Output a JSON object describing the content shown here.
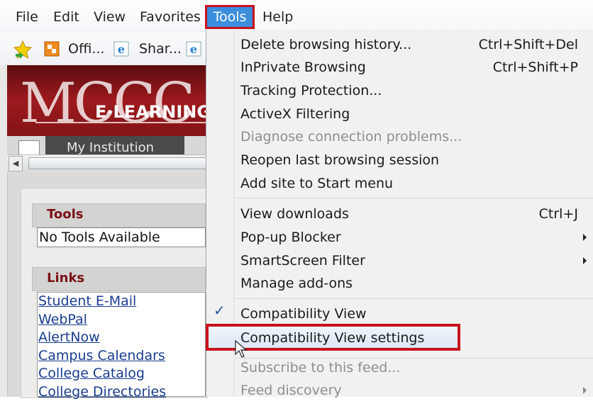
{
  "menubar": {
    "items": [
      "File",
      "Edit",
      "View",
      "Favorites",
      "Tools",
      "Help"
    ],
    "active": "Tools",
    "highlight_color": "#c8121d"
  },
  "favorites_bar": {
    "items": [
      "Offi...",
      "Shar..."
    ]
  },
  "banner": {
    "big_text": "MCCC",
    "sub_text": "E·LEARNING",
    "tab_label": "My Institution"
  },
  "sidebar": {
    "tools_header": "Tools",
    "tools_value": "No Tools Available",
    "links_header": "Links",
    "links": [
      "Student E-Mail",
      "WebPal",
      "AlertNow",
      "Campus Calendars",
      "College Catalog",
      "College Directories"
    ]
  },
  "tools_menu": {
    "items": [
      {
        "label": "Delete browsing history...",
        "shortcut": "Ctrl+Shift+Del"
      },
      {
        "label": "InPrivate Browsing",
        "shortcut": "Ctrl+Shift+P"
      },
      {
        "label": "Tracking Protection..."
      },
      {
        "label": "ActiveX Filtering"
      },
      {
        "label": "Diagnose connection problems...",
        "disabled": true
      },
      {
        "label": "Reopen last browsing session"
      },
      {
        "label": "Add site to Start menu"
      },
      {
        "label": "View downloads",
        "shortcut": "Ctrl+J"
      },
      {
        "label": "Pop-up Blocker",
        "submenu": true
      },
      {
        "label": "SmartScreen Filter",
        "submenu": true
      },
      {
        "label": "Manage add-ons"
      },
      {
        "label": "Compatibility View",
        "checked": true
      },
      {
        "label": "Compatibility View settings",
        "highlighted": true
      },
      {
        "label": "Subscribe to this feed...",
        "disabled": true
      },
      {
        "label": "Feed discovery",
        "disabled": true,
        "submenu": true
      }
    ]
  }
}
